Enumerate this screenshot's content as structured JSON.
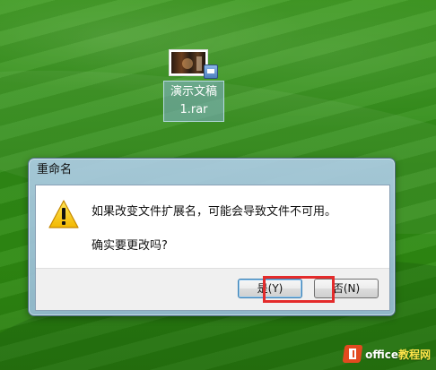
{
  "desktop_icon": {
    "name_line1": "演示文稿",
    "name_line2": "1.rar",
    "icon": "compressed-archive-icon"
  },
  "dialog": {
    "title": "重命名",
    "message": "如果改变文件扩展名，可能会导致文件不可用。",
    "confirm": "确实要更改吗?",
    "icon": "warning-icon",
    "buttons": {
      "yes": "是(Y)",
      "no": "否(N)"
    }
  },
  "watermark": {
    "brand": "office",
    "tail": "教程网"
  },
  "colors": {
    "highlight": "#e42b2b",
    "warning": "#f7c500"
  }
}
